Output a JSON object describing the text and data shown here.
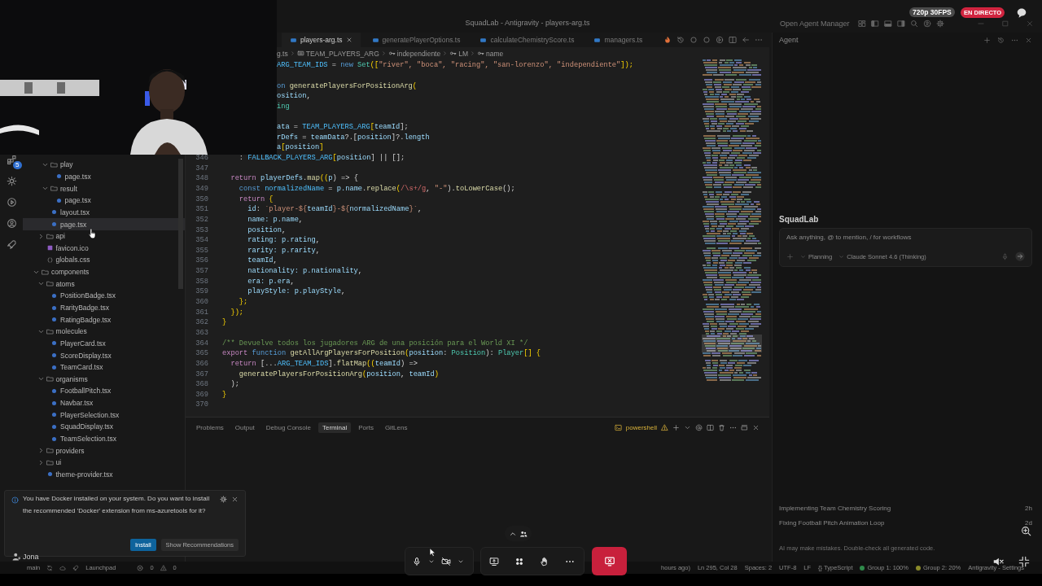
{
  "titlebar": {
    "title": "SquadLab - Antigravity - players-arg.ts",
    "agent_manager": "Open Agent Manager"
  },
  "stream": {
    "quality": "720p 30FPS",
    "live": "EN DIRECTO"
  },
  "activity_bar": {
    "badge": "5"
  },
  "explorer": {
    "tree": [
      {
        "children": [
          {
            "children": [
              {
                "label": "play",
                "kind": "folder",
                "expanded": true,
                "highlighted": false,
                "children": [
                  {
                    "label": "page.tsx",
                    "kind": "tsx",
                    "highlighted": false
                  }
                ]
              },
              {
                "label": "result",
                "kind": "folder",
                "expanded": true,
                "highlighted": false,
                "children": [
                  {
                    "label": "page.tsx",
                    "kind": "tsx",
                    "highlighted": false
                  }
                ]
              },
              {
                "label": "layout.tsx",
                "kind": "tsx",
                "highlighted": false
              },
              {
                "label": "page.tsx",
                "kind": "tsx",
                "highlighted": true
              }
            ]
          },
          {
            "label": "api",
            "kind": "folder",
            "expanded": false,
            "highlighted": false
          },
          {
            "label": "favicon.ico",
            "kind": "ico",
            "highlighted": false
          },
          {
            "label": "globals.css",
            "kind": "css",
            "highlighted": false
          }
        ]
      },
      {
        "label": "components",
        "kind": "folder",
        "expanded": true,
        "highlighted": false,
        "children": [
          {
            "label": "atoms",
            "kind": "folder",
            "expanded": true,
            "highlighted": false,
            "children": [
              {
                "label": "PositionBadge.tsx",
                "kind": "tsx",
                "highlighted": false
              },
              {
                "label": "RarityBadge.tsx",
                "kind": "tsx",
                "highlighted": false
              },
              {
                "label": "RatingBadge.tsx",
                "kind": "tsx",
                "highlighted": false
              }
            ]
          },
          {
            "label": "molecules",
            "kind": "folder",
            "expanded": true,
            "highlighted": false,
            "children": [
              {
                "label": "PlayerCard.tsx",
                "kind": "tsx",
                "highlighted": false
              },
              {
                "label": "ScoreDisplay.tsx",
                "kind": "tsx",
                "highlighted": false
              },
              {
                "label": "TeamCard.tsx",
                "kind": "tsx",
                "highlighted": false
              }
            ]
          },
          {
            "label": "organisms",
            "kind": "folder",
            "expanded": true,
            "highlighted": false,
            "children": [
              {
                "label": "FootballPitch.tsx",
                "kind": "tsx",
                "highlighted": false
              },
              {
                "label": "Navbar.tsx",
                "kind": "tsx",
                "highlighted": false
              },
              {
                "label": "PlayerSelection.tsx",
                "kind": "tsx",
                "highlighted": false
              },
              {
                "label": "SquadDisplay.tsx",
                "kind": "tsx",
                "highlighted": false
              },
              {
                "label": "TeamSelection.tsx",
                "kind": "tsx",
                "highlighted": false
              }
            ]
          },
          {
            "label": "providers",
            "kind": "folder",
            "expanded": false,
            "highlighted": false
          },
          {
            "label": "ui",
            "kind": "folder",
            "expanded": false,
            "highlighted": false
          },
          {
            "label": "theme-provider.tsx",
            "kind": "tsx",
            "highlighted": false
          }
        ]
      }
    ]
  },
  "editor": {
    "tabs": [
      {
        "label": "players-arg.ts",
        "selected": true
      },
      {
        "label": "generatePlayerOptions.ts",
        "selected": false
      },
      {
        "label": "calculateChemistryScore.ts",
        "selected": false
      },
      {
        "label": "managers.ts",
        "selected": false
      }
    ],
    "breadcrumb": [
      {
        "label": "g.ts",
        "kind": "file"
      },
      {
        "label": "TEAM_PLAYERS_ARG",
        "kind": "enum"
      },
      {
        "label": "independiente",
        "kind": "key"
      },
      {
        "label": "LM",
        "kind": "key"
      },
      {
        "label": "name",
        "kind": "key"
      }
    ],
    "lines": [
      {
        "kind": "partial",
        "tokens": [
          {
            "text": "ARG_TEAM_IDS",
            "kind": "const"
          },
          {
            "text": " = ",
            "kind": "punc"
          },
          {
            "text": "new",
            "kind": "decl"
          },
          {
            "text": " Set",
            "kind": "type"
          },
          {
            "text": "([",
            "kind": "br"
          },
          {
            "text": "\"river\", \"boca\", \"racing\", \"san-lorenzo\", \"independiente\"",
            "kind": "str"
          },
          {
            "text": "]);",
            "kind": "br"
          }
        ]
      },
      {
        "kind": "partial"
      },
      {
        "kind": "partial",
        "tokens": [
          {
            "text": "on",
            "kind": "decl"
          },
          {
            "text": " generatePlayersForPositionArg",
            "kind": "fn"
          },
          {
            "text": "(",
            "kind": "br"
          }
        ]
      },
      {
        "kind": "partial",
        "tokens": [
          {
            "text": "osition",
            "kind": "var"
          },
          {
            "text": ",",
            "kind": "punc"
          }
        ]
      },
      {
        "kind": "partial",
        "tokens": [
          {
            "text": "ing",
            "kind": "type"
          }
        ]
      },
      {
        "kind": "partial"
      },
      {
        "kind": "partial",
        "tokens": [
          {
            "text": "ata",
            "kind": "var"
          },
          {
            "text": " = ",
            "kind": "punc"
          },
          {
            "text": "TEAM_PLAYERS_ARG",
            "kind": "const"
          },
          {
            "text": "[",
            "kind": "br"
          },
          {
            "text": "teamId",
            "kind": "var"
          },
          {
            "text": "];",
            "kind": "punc"
          }
        ]
      },
      {
        "kind": "partial",
        "tokens": [
          {
            "text": "rDefs",
            "kind": "var"
          },
          {
            "text": " = ",
            "kind": "punc"
          },
          {
            "text": "teamData",
            "kind": "var"
          },
          {
            "text": "?.[",
            "kind": "punc"
          },
          {
            "text": "position",
            "kind": "var"
          },
          {
            "text": "]?.",
            "kind": "punc"
          },
          {
            "text": "length",
            "kind": "var"
          }
        ]
      },
      {
        "kind": "partial",
        "tokens": [
          {
            "text": "a",
            "kind": "var"
          },
          {
            "text": "[",
            "kind": "br"
          },
          {
            "text": "position",
            "kind": "var"
          },
          {
            "text": "]",
            "kind": "br"
          }
        ]
      },
      {
        "kind": "full",
        "number": "346",
        "tokens": [
          {
            "text": "    : ",
            "kind": "punc"
          },
          {
            "text": "FALLBACK_PLAYERS_ARG",
            "kind": "const"
          },
          {
            "text": "[",
            "kind": "br"
          },
          {
            "text": "position",
            "kind": "var"
          },
          {
            "text": "] || [];",
            "kind": "punc"
          }
        ]
      },
      {
        "kind": "full",
        "number": "347"
      },
      {
        "kind": "full",
        "number": "348",
        "tokens": [
          {
            "text": "  return ",
            "kind": "kw"
          },
          {
            "text": "playerDefs",
            "kind": "var"
          },
          {
            "text": ".",
            "kind": "punc"
          },
          {
            "text": "map",
            "kind": "fn"
          },
          {
            "text": "((",
            "kind": "br"
          },
          {
            "text": "p",
            "kind": "var"
          },
          {
            "text": ") => {",
            "kind": "punc"
          }
        ]
      },
      {
        "kind": "full",
        "number": "349",
        "tokens": [
          {
            "text": "    const ",
            "kind": "decl"
          },
          {
            "text": "normalizedName",
            "kind": "const"
          },
          {
            "text": " = ",
            "kind": "punc"
          },
          {
            "text": "p.name",
            "kind": "var"
          },
          {
            "text": ".",
            "kind": "punc"
          },
          {
            "text": "replace",
            "kind": "fn"
          },
          {
            "text": "(",
            "kind": "br"
          },
          {
            "text": "/\\s+/g",
            "kind": "re"
          },
          {
            "text": ", ",
            "kind": "punc"
          },
          {
            "text": "\"-\"",
            "kind": "str"
          },
          {
            "text": ").",
            "kind": "punc"
          },
          {
            "text": "toLowerCase",
            "kind": "fn"
          },
          {
            "text": "();",
            "kind": "punc"
          }
        ]
      },
      {
        "kind": "full",
        "number": "350",
        "tokens": [
          {
            "text": "    return",
            "kind": "kw"
          },
          {
            "text": " {",
            "kind": "br"
          }
        ]
      },
      {
        "kind": "full",
        "number": "351",
        "tokens": [
          {
            "text": "      id",
            "kind": "var"
          },
          {
            "text": ": ",
            "kind": "punc"
          },
          {
            "text": "`player-${",
            "kind": "str"
          },
          {
            "text": "teamId",
            "kind": "var"
          },
          {
            "text": "}-${",
            "kind": "str"
          },
          {
            "text": "normalizedName",
            "kind": "var"
          },
          {
            "text": "}`",
            "kind": "str"
          },
          {
            "text": ",",
            "kind": "punc"
          }
        ]
      },
      {
        "kind": "full",
        "number": "352",
        "tokens": [
          {
            "text": "      name: p.name",
            "kind": "var"
          },
          {
            "text": ",",
            "kind": "punc"
          }
        ]
      },
      {
        "kind": "full",
        "number": "353",
        "tokens": [
          {
            "text": "      position",
            "kind": "var"
          },
          {
            "text": ",",
            "kind": "punc"
          }
        ]
      },
      {
        "kind": "full",
        "number": "354",
        "tokens": [
          {
            "text": "      rating: p.rating",
            "kind": "var"
          },
          {
            "text": ",",
            "kind": "punc"
          }
        ]
      },
      {
        "kind": "full",
        "number": "355",
        "tokens": [
          {
            "text": "      rarity: p.rarity",
            "kind": "var"
          },
          {
            "text": ",",
            "kind": "punc"
          }
        ]
      },
      {
        "kind": "full",
        "number": "356",
        "tokens": [
          {
            "text": "      teamId",
            "kind": "var"
          },
          {
            "text": ",",
            "kind": "punc"
          }
        ]
      },
      {
        "kind": "full",
        "number": "357",
        "tokens": [
          {
            "text": "      nationality: p.nationality",
            "kind": "var"
          },
          {
            "text": ",",
            "kind": "punc"
          }
        ]
      },
      {
        "kind": "full",
        "number": "358",
        "tokens": [
          {
            "text": "      era: p.era",
            "kind": "var"
          },
          {
            "text": ",",
            "kind": "punc"
          }
        ]
      },
      {
        "kind": "full",
        "number": "359",
        "tokens": [
          {
            "text": "      playStyle: p.playStyle",
            "kind": "var"
          },
          {
            "text": ",",
            "kind": "punc"
          }
        ]
      },
      {
        "kind": "full",
        "number": "360",
        "tokens": [
          {
            "text": "    };",
            "kind": "br"
          }
        ]
      },
      {
        "kind": "full",
        "number": "361",
        "tokens": [
          {
            "text": "  });",
            "kind": "br"
          }
        ]
      },
      {
        "kind": "full",
        "number": "362",
        "tokens": [
          {
            "text": "}",
            "kind": "br"
          }
        ]
      },
      {
        "kind": "full",
        "number": "363"
      },
      {
        "kind": "full",
        "number": "364",
        "tokens": [
          {
            "text": "/** Devuelve todos los jugadores ARG de una posición para el World XI */",
            "kind": "cmt"
          }
        ]
      },
      {
        "kind": "full",
        "number": "365",
        "tokens": [
          {
            "text": "export ",
            "kind": "kw"
          },
          {
            "text": "function",
            "kind": "decl"
          },
          {
            "text": " getAllArgPlayersForPosition",
            "kind": "fn"
          },
          {
            "text": "(",
            "kind": "br"
          },
          {
            "text": "position",
            "kind": "var"
          },
          {
            "text": ": ",
            "kind": "punc"
          },
          {
            "text": "Position",
            "kind": "type"
          },
          {
            "text": "): ",
            "kind": "punc"
          },
          {
            "text": "Player",
            "kind": "type"
          },
          {
            "text": "[] {",
            "kind": "br"
          }
        ]
      },
      {
        "kind": "full",
        "number": "366",
        "tokens": [
          {
            "text": "  return",
            "kind": "kw"
          },
          {
            "text": " [...",
            "kind": "punc"
          },
          {
            "text": "ARG_TEAM_IDS",
            "kind": "const"
          },
          {
            "text": "].",
            "kind": "punc"
          },
          {
            "text": "flatMap",
            "kind": "fn"
          },
          {
            "text": "((",
            "kind": "br"
          },
          {
            "text": "teamId",
            "kind": "var"
          },
          {
            "text": ") =>",
            "kind": "punc"
          }
        ]
      },
      {
        "kind": "full",
        "number": "367",
        "tokens": [
          {
            "text": "    generatePlayersForPositionArg",
            "kind": "fn"
          },
          {
            "text": "(",
            "kind": "br"
          },
          {
            "text": "position",
            "kind": "var"
          },
          {
            "text": ", ",
            "kind": "punc"
          },
          {
            "text": "teamId",
            "kind": "var"
          },
          {
            "text": ")",
            "kind": "br"
          }
        ]
      },
      {
        "kind": "full",
        "number": "368",
        "tokens": [
          {
            "text": "  );",
            "kind": "punc"
          }
        ]
      },
      {
        "kind": "full",
        "number": "369",
        "tokens": [
          {
            "text": "}",
            "kind": "br"
          }
        ]
      },
      {
        "kind": "full",
        "number": "370"
      }
    ]
  },
  "panel": {
    "tabs": [
      {
        "label": "Problems",
        "selected": false
      },
      {
        "label": "Output",
        "selected": false
      },
      {
        "label": "Debug Console",
        "selected": false
      },
      {
        "label": "Terminal",
        "selected": true
      },
      {
        "label": "Ports",
        "selected": false
      },
      {
        "label": "GitLens",
        "selected": false
      }
    ],
    "shell": "powershell"
  },
  "notification": {
    "message": "You have Docker installed on your system. Do you want to install the recommended 'Docker' extension from ms-azuretools for it?",
    "buttons": [
      {
        "label": "Install",
        "kind": "primary"
      },
      {
        "label": "Show Recommendations",
        "kind": "secondary"
      }
    ]
  },
  "agent": {
    "title": "Agent",
    "project": "SquadLab",
    "input": {
      "placeholder": "Ask anything, @ to mention, / for workflows",
      "mode": "Planning",
      "model": "Claude Sonnet 4.6 (Thinking)"
    },
    "conversations": [
      {
        "title": "Implementing Team Chemistry Scoring",
        "age": "2h"
      },
      {
        "title": "Fixing Football Pitch Animation Loop",
        "age": "2d"
      }
    ],
    "disclaimer": "AI may make mistakes. Double-check all generated code."
  },
  "status_bar": {
    "left": [
      {
        "kind": "branch",
        "text": "main"
      },
      {
        "kind": "launchpad",
        "text": "Launchpad"
      },
      {
        "kind": "errors",
        "text": "0"
      },
      {
        "kind": "warnings",
        "text": "0"
      }
    ],
    "right": [
      {
        "text": "hours ago)"
      },
      {
        "text": "Ln 295, Col 28"
      },
      {
        "text": "Spaces: 2"
      },
      {
        "text": "UTF-8"
      },
      {
        "text": "LF"
      },
      {
        "text": "{} TypeScript"
      },
      {
        "text": "Group 1: 100%",
        "color": "#2f8a4a"
      },
      {
        "text": "Group 2: 20%",
        "color": "#8a8a2a"
      },
      {
        "text": "Antigravity - Settings"
      }
    ]
  },
  "call": {
    "participant": "Jona"
  }
}
